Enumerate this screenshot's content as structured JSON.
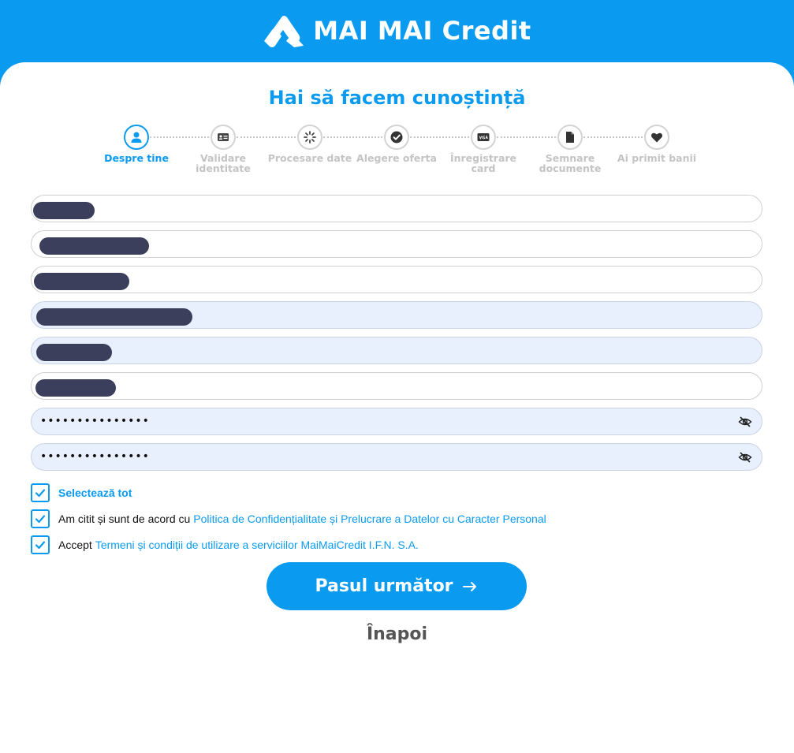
{
  "brand": {
    "name": "MAI MAI Credit",
    "color": "#0a9bf0"
  },
  "page": {
    "title": "Hai să facem cunoștință"
  },
  "stepper": {
    "steps": [
      {
        "label": "Despre tine",
        "icon": "user-icon",
        "active": true
      },
      {
        "label": "Validare identitate",
        "icon": "id-card-icon",
        "active": false
      },
      {
        "label": "Procesare date",
        "icon": "spinner-icon",
        "active": false
      },
      {
        "label": "Alegere oferta",
        "icon": "check-circle-icon",
        "active": false
      },
      {
        "label": "Înregistrare card",
        "icon": "visa-card-icon",
        "active": false
      },
      {
        "label": "Semnare documente",
        "icon": "document-icon",
        "active": false
      },
      {
        "label": "Ai primit banii",
        "icon": "heart-icon",
        "active": false
      }
    ]
  },
  "form": {
    "password": {
      "value": "•••••••••••••••",
      "icon": "eye-off-icon"
    },
    "confirm_password": {
      "value": "•••••••••••••••",
      "icon": "eye-off-icon"
    }
  },
  "consents": {
    "select_all": "Selectează tot",
    "privacy_prefix": "Am citit și sunt de acord cu",
    "privacy_link": "Politica de Confidențialitate și Prelucrare a Datelor cu Caracter Personal",
    "terms_prefix": "Accept",
    "terms_link": "Termeni și condiții de utilizare a serviciilor MaiMaiCredit I.F.N. S.A."
  },
  "actions": {
    "next": "Pasul următor",
    "back": "Înapoi"
  }
}
